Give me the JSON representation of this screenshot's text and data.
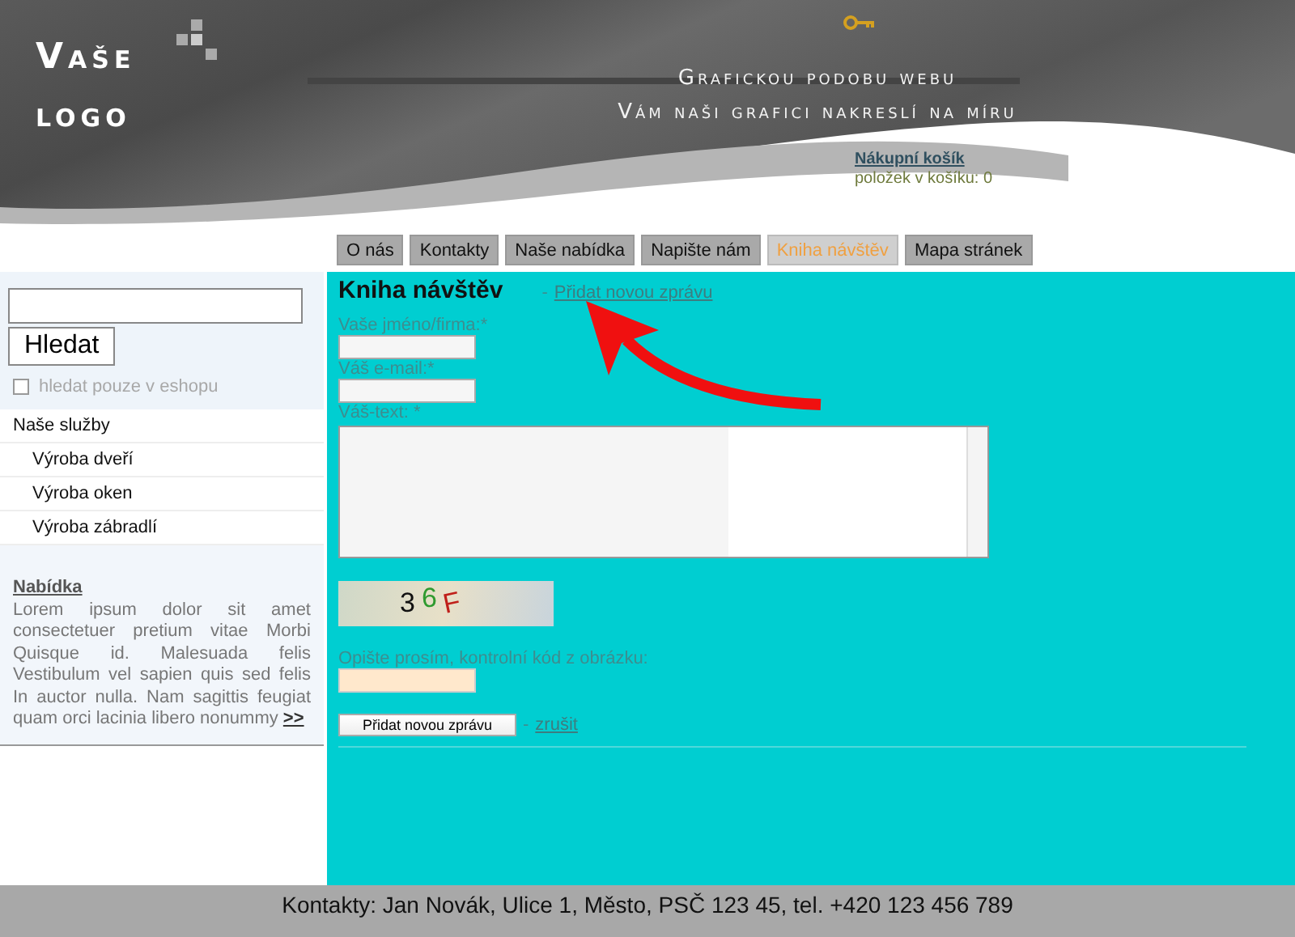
{
  "header": {
    "logo_lines": [
      "Vaše",
      "logo"
    ],
    "slogan_lines": [
      "Grafickou podobu webu",
      "Vám naši grafici nakreslí na míru"
    ],
    "cart": {
      "link": "Nákupní košík",
      "count": "položek v košíku: 0"
    }
  },
  "tabs": [
    {
      "label": "O nás",
      "selected": false
    },
    {
      "label": "Kontakty",
      "selected": false
    },
    {
      "label": "Naše nabídka",
      "selected": false
    },
    {
      "label": "Napište nám",
      "selected": false
    },
    {
      "label": "Kniha návštěv",
      "selected": true
    },
    {
      "label": "Mapa stránek",
      "selected": false
    }
  ],
  "sidebar": {
    "search_button": "Hledat",
    "eshop_only": {
      "label": "hledat pouze v eshopu",
      "checked": false
    },
    "menu": [
      {
        "label": "Naše služby",
        "children": [
          {
            "label": "Výroba dveří"
          },
          {
            "label": "Výroba oken"
          },
          {
            "label": "Výroba zábradlí"
          }
        ]
      }
    ],
    "offer": {
      "title": "Nabídka",
      "text": "Lorem ipsum dolor sit amet consectetuer pretium vitae Morbi Quisque id. Malesuada felis Vestibulum vel sapien quis sed felis In auctor nulla. Nam sagittis feugiat quam orci lacinia libero nonummy",
      "more": ">>"
    }
  },
  "guestbook": {
    "title": "Kniha návštěv",
    "add_link": "Přidat novou zprávu",
    "separator": "-",
    "fields": [
      {
        "label": "Vaše jméno/firma:*",
        "kind": "input"
      },
      {
        "label": "Váš e-mail:*",
        "kind": "input"
      },
      {
        "label": "Váš-text: *",
        "kind": "textarea"
      }
    ],
    "captcha": [
      {
        "char": "3",
        "color": "#111111"
      },
      {
        "char": "6",
        "color": "#2f9a2f"
      },
      {
        "char": "F",
        "color": "#c0201a"
      }
    ],
    "captcha_label": "Opište prosím, kontrolní kód z obrázku:",
    "submit": "Přidat novou zprávu",
    "cancel": "zrušit"
  },
  "footer": "Kontakty: Jan Novák, Ulice 1, Město, PSČ 123 45, tel. +420 123 456 789"
}
